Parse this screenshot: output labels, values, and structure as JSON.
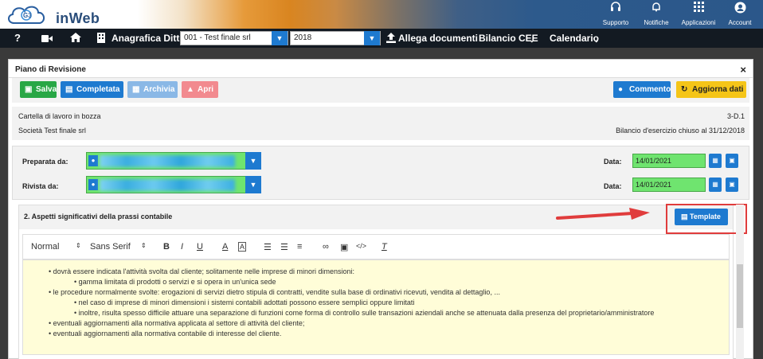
{
  "header": {
    "app_name": "inWeb",
    "items": [
      {
        "label": "Supporto",
        "icon": "headset-icon"
      },
      {
        "label": "Notifiche",
        "icon": "bell-icon"
      },
      {
        "label": "Applicazioni",
        "icon": "grid-icon"
      },
      {
        "label": "Account",
        "icon": "user-icon"
      }
    ]
  },
  "nav": {
    "help": "?",
    "anagrafica_label": "Anagrafica Ditte",
    "company_value": "001 - Test finale srl",
    "year_value": "2018",
    "allega_label": "Allega documenti",
    "bilancio_label": "Bilancio CEE",
    "calendario_label": "Calendario"
  },
  "modal": {
    "title": "Piano di Revisione",
    "close": "×",
    "toolbar": {
      "salva": "Salva",
      "completata": "Completata",
      "archivia": "Archivia",
      "apri": "Apri",
      "commento": "Commento",
      "aggiorna": "Aggiorna dati"
    },
    "info": {
      "status": "Cartella di lavoro in bozza",
      "code": "3-D.1",
      "company": "Società Test finale srl",
      "bilancio": "Bilancio d'esercizio chiuso al 31/12/2018"
    },
    "people": {
      "preparata_label": "Preparata da:",
      "rivista_label": "Rivista da:",
      "data_label": "Data:",
      "preparata_date": "14/01/2021",
      "rivista_date": "14/01/2021"
    },
    "section": {
      "title": "2. Aspetti significativi della prassi contabile",
      "template_btn": "Template",
      "editor_toolbar": {
        "format": "Normal",
        "font": "Sans Serif",
        "bold": "B",
        "italic": "I",
        "underline": "U",
        "font_color": "A",
        "bg_color": "A",
        "clear": "T"
      },
      "lines": [
        "• dovrà essere indicata l'attività svolta dal cliente; solitamente nelle imprese di minori dimensioni:",
        "• gamma limitata di prodotti o servizi e si opera in un'unica sede",
        "• le procedure normalmente svolte: erogazioni di servizi dietro stipula di contratti, vendite sulla base di ordinativi ricevuti, vendita al dettaglio, ...",
        "• nel caso di imprese di minori dimensioni i sistemi contabili adottati possono essere semplici oppure limitati",
        "• inoltre, risulta spesso difficile attuare una separazione di funzioni come forma di controllo sulle transazioni aziendali anche se attenuata dalla presenza del proprietario/amministratore",
        "• eventuali aggiornamenti alla normativa applicata al settore di attività del cliente;",
        "• eventuali aggiornamenti alla normativa contabile di interesse del cliente."
      ]
    }
  },
  "colors": {
    "primary": "#1e7ad0",
    "success": "#28a745",
    "warning": "#f5c518",
    "danger_light": "#f28a8f",
    "highlight": "#e03c3c"
  }
}
